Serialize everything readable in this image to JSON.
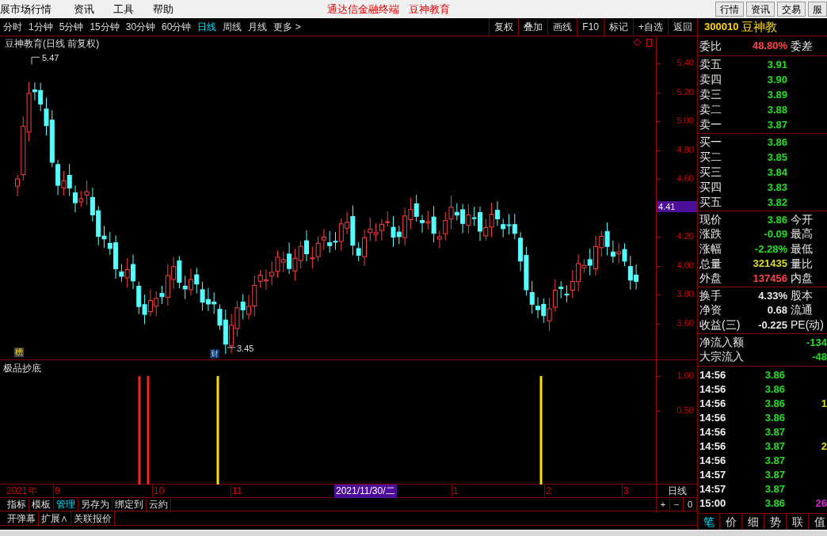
{
  "menubar": {
    "items": [
      "展市场行情",
      "资讯",
      "工具",
      "帮助"
    ],
    "title_parts": [
      "通达信金融终端",
      "豆神教育"
    ],
    "buttons": [
      "行情",
      "资讯",
      "交易",
      "服"
    ]
  },
  "period_bar": {
    "periods": [
      {
        "label": "分时",
        "selected": false
      },
      {
        "label": "1分钟",
        "selected": false
      },
      {
        "label": "5分钟",
        "selected": false
      },
      {
        "label": "15分钟",
        "selected": false
      },
      {
        "label": "30分钟",
        "selected": false
      },
      {
        "label": "60分钟",
        "selected": false
      },
      {
        "label": "日线",
        "selected": true
      },
      {
        "label": "周线",
        "selected": false
      },
      {
        "label": "月线",
        "selected": false
      },
      {
        "label": "更多 >",
        "selected": false
      }
    ],
    "tools": [
      "复权",
      "叠加",
      "画线",
      "F10",
      "标记",
      "+自选",
      "返回"
    ]
  },
  "chart": {
    "title": "豆神教育(日线 前复权)",
    "price_ticks": [
      "5.40",
      "5.20",
      "5.00",
      "4.80",
      "4.60",
      "4.20",
      "4.00",
      "3.80",
      "3.60"
    ],
    "current_price_label": "4.41",
    "high_mark": "5.47",
    "low_mark": "3.45",
    "badges": [
      "榜",
      "财"
    ]
  },
  "indicator": {
    "title": "极品抄底",
    "ticks": [
      "1.00",
      "0.50"
    ]
  },
  "date_axis": {
    "labels": [
      "2021年",
      "9",
      "10",
      "11",
      "1",
      "2",
      "3"
    ],
    "cursor_date": "2021/11/30/二",
    "period": "日线"
  },
  "bottom_tabs": [
    {
      "label": "指标",
      "selected": false
    },
    {
      "label": "模板",
      "selected": false
    },
    {
      "label": "管理",
      "selected": true
    },
    {
      "label": "另存为",
      "selected": false
    },
    {
      "label": "绑定到",
      "selected": false
    },
    {
      "label": "云約",
      "selected": false
    }
  ],
  "zoom_buttons": [
    "+",
    "−",
    "0"
  ],
  "bottom_row": [
    "开弹幕",
    "扩展∧",
    "关联报价"
  ],
  "quote": {
    "code": "300010",
    "name": "豆神教",
    "ratio": {
      "label": "委比",
      "value": "48.80%",
      "label2": "委差"
    },
    "asks": [
      {
        "label": "卖五",
        "price": "3.91"
      },
      {
        "label": "卖四",
        "price": "3.90"
      },
      {
        "label": "卖三",
        "price": "3.89"
      },
      {
        "label": "卖二",
        "price": "3.88"
      },
      {
        "label": "卖一",
        "price": "3.87"
      }
    ],
    "bids": [
      {
        "label": "买一",
        "price": "3.86"
      },
      {
        "label": "买二",
        "price": "3.85"
      },
      {
        "label": "买三",
        "price": "3.84"
      },
      {
        "label": "买四",
        "price": "3.83"
      },
      {
        "label": "买五",
        "price": "3.82"
      }
    ],
    "stats": [
      {
        "label": "现价",
        "value": "3.86",
        "color": "#22dd22",
        "label2": "今开"
      },
      {
        "label": "涨跌",
        "value": "-0.09",
        "color": "#22dd22",
        "label2": "最高"
      },
      {
        "label": "涨幅",
        "value": "-2.28%",
        "color": "#22dd22",
        "label2": "最低"
      },
      {
        "label": "总量",
        "value": "321435",
        "color": "#dddd22",
        "label2": "量比"
      },
      {
        "label": "外盘",
        "value": "137456",
        "color": "#ff4444",
        "label2": "内盘"
      }
    ],
    "fundamentals": [
      {
        "label": "换手",
        "value": "4.33%",
        "label2": "股本"
      },
      {
        "label": "净资",
        "value": "0.68",
        "label2": "流通"
      },
      {
        "label": "收益(三)",
        "value": "-0.225",
        "label2": "PE(动)"
      }
    ],
    "flows": [
      {
        "label": "净流入额",
        "value": "-134"
      },
      {
        "label": "大宗流入",
        "value": "-48"
      }
    ],
    "ticks": [
      {
        "time": "14:56",
        "price": "3.86"
      },
      {
        "time": "14:56",
        "price": "3.86"
      },
      {
        "time": "14:56",
        "price": "3.86",
        "volume": "1",
        "color": "#dddd22"
      },
      {
        "time": "14:56",
        "price": "3.86"
      },
      {
        "time": "14:56",
        "price": "3.87"
      },
      {
        "time": "14:56",
        "price": "3.87",
        "volume": "2",
        "color": "#dddd22"
      },
      {
        "time": "14:56",
        "price": "3.87"
      },
      {
        "time": "14:57",
        "price": "3.87"
      },
      {
        "time": "14:57",
        "price": "3.87"
      },
      {
        "time": "15:00",
        "price": "3.86",
        "volume": "26",
        "color": "#dd22dd"
      }
    ],
    "tabs": [
      {
        "label": "笔",
        "selected": true
      },
      {
        "label": "价",
        "selected": false
      },
      {
        "label": "细",
        "selected": false
      },
      {
        "label": "势",
        "selected": false
      },
      {
        "label": "联",
        "selected": false
      },
      {
        "label": "值",
        "selected": false
      }
    ]
  }
}
